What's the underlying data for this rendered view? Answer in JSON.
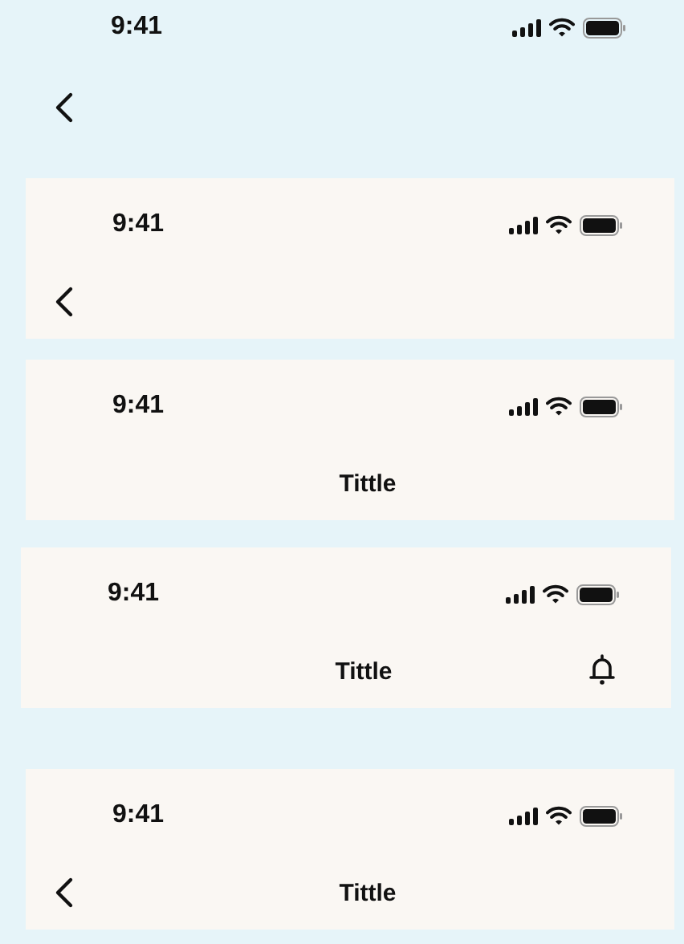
{
  "headers": [
    {
      "framed": false,
      "time": "9:41",
      "back": true
    },
    {
      "framed": true,
      "time": "9:41",
      "back": true
    },
    {
      "framed": true,
      "time": "9:41",
      "back": false,
      "title": "Tittle"
    },
    {
      "framed": true,
      "time": "9:41",
      "back": false,
      "title": "Tittle",
      "bell": true
    },
    {
      "framed": true,
      "time": "9:41",
      "back": true,
      "title": "Tittle"
    }
  ]
}
